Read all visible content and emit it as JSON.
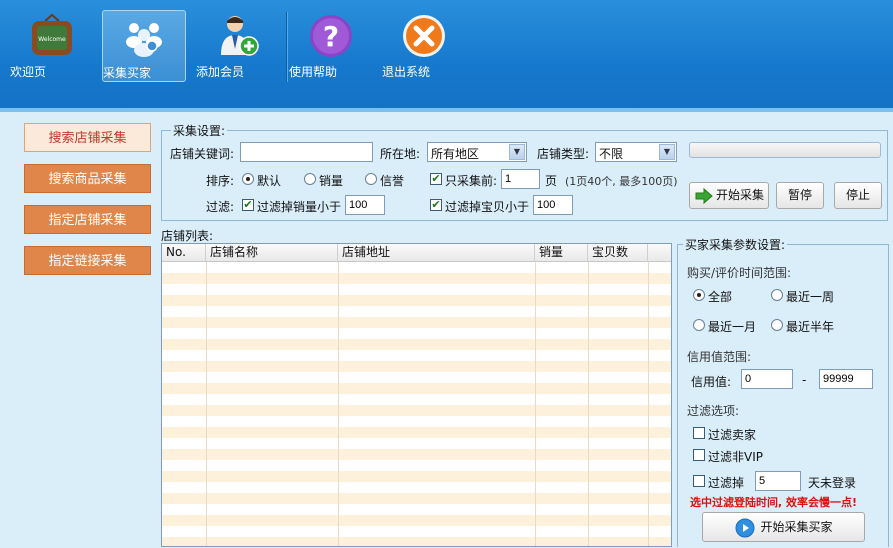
{
  "toolbar": {
    "items": [
      {
        "label": "欢迎页",
        "icon": "welcome-board-icon"
      },
      {
        "label": "采集买家",
        "icon": "users-icon"
      },
      {
        "label": "添加会员",
        "icon": "add-user-icon"
      },
      {
        "label": "使用帮助",
        "icon": "help-icon"
      },
      {
        "label": "退出系统",
        "icon": "exit-icon"
      }
    ]
  },
  "nav": {
    "items": [
      {
        "label": "搜索店铺采集"
      },
      {
        "label": "搜索商品采集"
      },
      {
        "label": "指定店铺采集"
      },
      {
        "label": "指定链接采集"
      }
    ]
  },
  "settings": {
    "title": "采集设置:",
    "keyword_label": "店铺关键词:",
    "keyword_value": "",
    "location_label": "所在地:",
    "location_value": "所有地区",
    "type_label": "店铺类型:",
    "type_value": "不限",
    "sort_label": "排序:",
    "sort_options": [
      "默认",
      "销量",
      "信誉"
    ],
    "only_first_label": "只采集前:",
    "pages_value": "1",
    "pages_unit": "页",
    "pages_hint": "(1页40个, 最多100页)",
    "filter_label": "过滤:",
    "filter_sales_label": "过滤掉销量小于",
    "filter_sales_value": "100",
    "filter_items_label": "过滤掉宝贝小于",
    "filter_items_value": "100",
    "start_label": "开始采集",
    "pause_label": "暂停",
    "stop_label": "停止"
  },
  "table": {
    "title": "店铺列表:",
    "columns": [
      "No.",
      "店铺名称",
      "店铺地址",
      "销量",
      "宝贝数"
    ]
  },
  "buyer_params": {
    "title": "买家采集参数设置:",
    "time_range_label": "购买/评价时间范围:",
    "time_options": [
      "全部",
      "最近一周",
      "最近一月",
      "最近半年"
    ],
    "credit_range_label": "信用值范围:",
    "credit_label": "信用值:",
    "credit_min": "0",
    "credit_dash": "-",
    "credit_max": "99999",
    "filter_options_label": "过滤选项:",
    "filter_seller": "过滤卖家",
    "filter_nonvip": "过滤非VIP",
    "filter_login_prefix": "过滤掉",
    "filter_login_days": "5",
    "filter_login_suffix": "天未登录",
    "warning": "选中过滤登陆时间, 效率会慢一点!",
    "start_label": "开始采集买家"
  },
  "colors": {
    "toolbar_blue": "#1678cc",
    "nav_orange": "#e0864a",
    "panel_bg": "#daeefa",
    "row_stripe": "#fdf1dc",
    "warning_red": "#e01010"
  }
}
